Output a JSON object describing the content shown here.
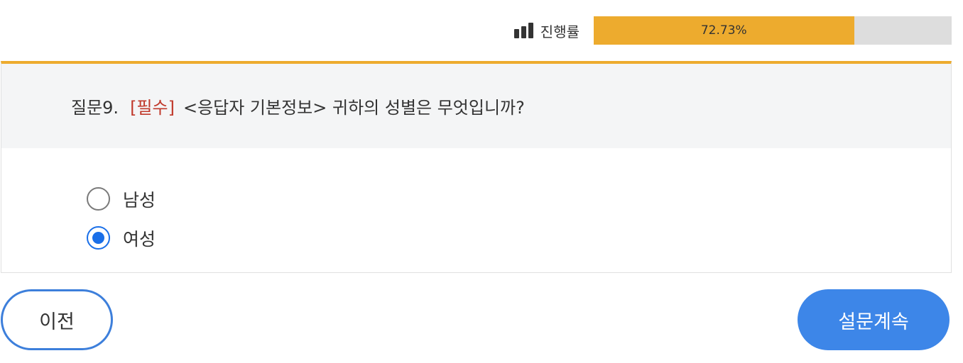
{
  "progress": {
    "label": "진행률",
    "value_percent": 72.73,
    "text": "72.73%",
    "icon": "bar-chart-icon",
    "fill_color": "#edab2e",
    "track_color": "#dddddd"
  },
  "question": {
    "number": "질문9.",
    "required_tag": "[필수]",
    "text": "<응답자 기본정보> 귀하의 성별은 무엇입니까?",
    "accent_color": "#edab2e",
    "required_color": "#c0392b"
  },
  "options": [
    {
      "label": "남성",
      "selected": false
    },
    {
      "label": "여성",
      "selected": true
    }
  ],
  "buttons": {
    "prev_label": "이전",
    "next_label": "설문계속",
    "primary_color": "#3d86e8"
  }
}
